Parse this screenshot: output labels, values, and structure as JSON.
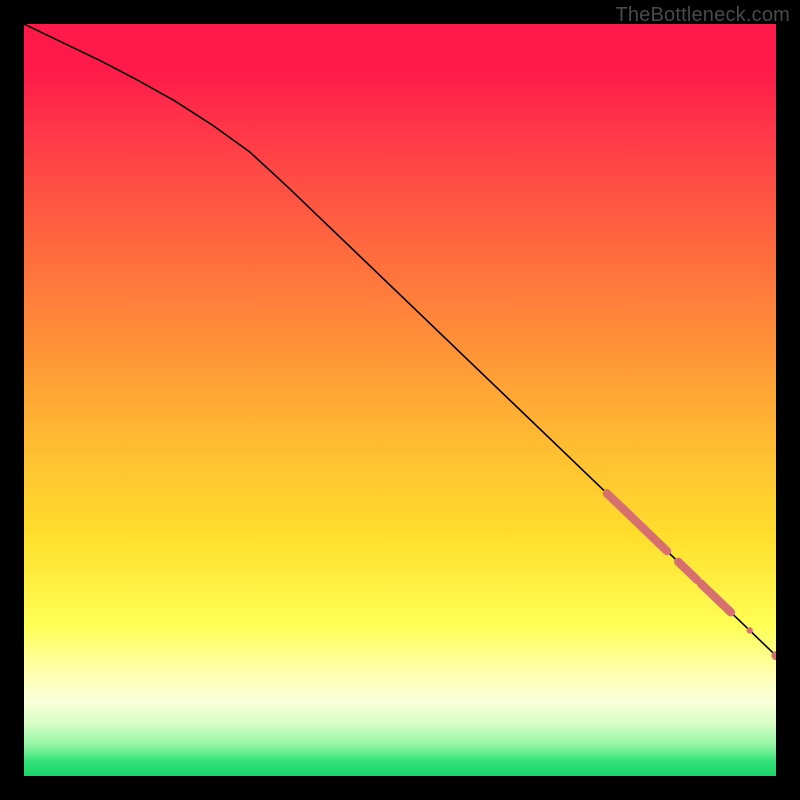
{
  "watermark": "TheBottleneck.com",
  "chart_data": {
    "type": "line",
    "title": "",
    "xlabel": "",
    "ylabel": "",
    "xlim": [
      0,
      100
    ],
    "ylim": [
      0,
      100
    ],
    "grid": false,
    "legend": false,
    "series": [
      {
        "name": "curve",
        "stroke": "#000000",
        "stroke_width": 1.6,
        "x": [
          0,
          5,
          10,
          15,
          20,
          25,
          30,
          35,
          40,
          45,
          50,
          55,
          60,
          65,
          70,
          75,
          80,
          85,
          90,
          95,
          100
        ],
        "y": [
          100.0,
          97.6,
          95.2,
          92.6,
          89.8,
          86.6,
          83.0,
          78.4,
          73.6,
          68.8,
          64.0,
          59.2,
          54.4,
          49.6,
          44.8,
          40.0,
          35.2,
          30.4,
          25.6,
          20.8,
          16.0
        ]
      }
    ],
    "markers": [
      {
        "kind": "thick-segment",
        "x0": 77.5,
        "x1": 85.5,
        "radius": 4.2,
        "color": "#d86f6f"
      },
      {
        "kind": "thick-segment",
        "x0": 87.0,
        "x1": 89.5,
        "radius": 4.2,
        "color": "#d86f6f"
      },
      {
        "kind": "thick-segment",
        "x0": 90.0,
        "x1": 94.0,
        "radius": 4.2,
        "color": "#d86f6f"
      },
      {
        "kind": "dot",
        "x": 96.5,
        "radius": 3.2,
        "color": "#d86f6f"
      },
      {
        "kind": "dot",
        "x": 100.0,
        "radius": 4.6,
        "color": "#d86f6f"
      }
    ],
    "gradient_stops": [
      {
        "pct": 0,
        "color": "#ff1a4a"
      },
      {
        "pct": 6,
        "color": "#ff1a4a"
      },
      {
        "pct": 15,
        "color": "#ff3a48"
      },
      {
        "pct": 30,
        "color": "#ff6a3e"
      },
      {
        "pct": 42,
        "color": "#ff8f38"
      },
      {
        "pct": 55,
        "color": "#ffb932"
      },
      {
        "pct": 68,
        "color": "#ffde2c"
      },
      {
        "pct": 80,
        "color": "#ffff55"
      },
      {
        "pct": 87,
        "color": "#ffffb8"
      },
      {
        "pct": 90,
        "color": "#f8ffd8"
      },
      {
        "pct": 93,
        "color": "#d8ffc8"
      },
      {
        "pct": 96,
        "color": "#8df5a0"
      },
      {
        "pct": 98,
        "color": "#34e37a"
      },
      {
        "pct": 100,
        "color": "#19d46a"
      }
    ]
  }
}
